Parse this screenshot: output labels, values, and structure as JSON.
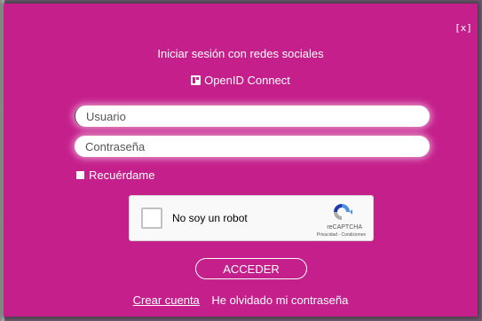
{
  "dialog": {
    "close_label": "[x]",
    "social_title": "Iniciar sesión con redes sociales",
    "openid_label": "OpenID Connect",
    "openid_icon": "openid-connect-icon"
  },
  "form": {
    "username_placeholder": "Usuario",
    "username_value": "",
    "password_placeholder": "Contraseña",
    "password_value": "",
    "remember_label": "Recuérdame",
    "remember_checked": false,
    "submit_label": "ACCEDER"
  },
  "captcha": {
    "label": "No soy un robot",
    "brand": "reCAPTCHA",
    "links": "Privacidad - Condiciones",
    "icon": "recaptcha-logo-icon"
  },
  "footer": {
    "create_account": "Crear cuenta",
    "forgot_password": "He olvidado mi contraseña"
  },
  "colors": {
    "dialog_background": "#c51f8c",
    "text": "#ffffff"
  }
}
